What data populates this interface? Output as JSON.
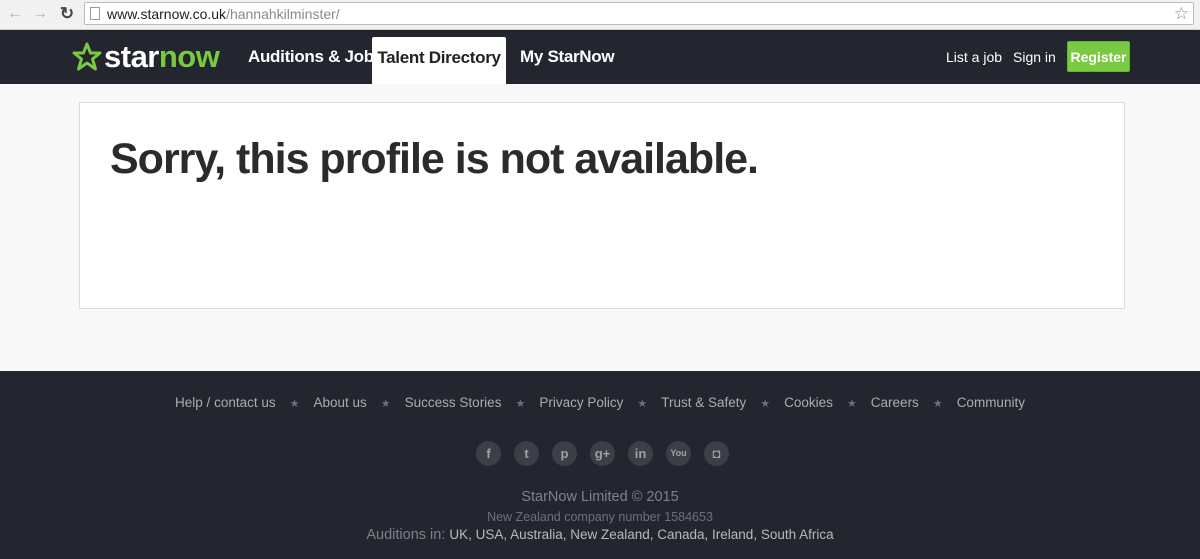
{
  "browser": {
    "url_domain": "www.starnow.co.uk",
    "url_path": "/hannahkilminster/",
    "icons": {
      "back": "back-arrow-icon",
      "forward": "forward-arrow-icon",
      "reload": "reload-icon",
      "bookmark": "bookmark-star-icon"
    }
  },
  "header": {
    "logo_white": "star",
    "logo_green": "now",
    "nav": {
      "auditions": "Auditions & Jobs",
      "talent": "Talent Directory",
      "mystarnow": "My StarNow"
    },
    "list_job": "List a job",
    "sign_in": "Sign in",
    "register": "Register"
  },
  "main": {
    "title": "Sorry, this profile is not available."
  },
  "footer": {
    "links": [
      "Help / contact us",
      "About us",
      "Success Stories",
      "Privacy Policy",
      "Trust & Safety",
      "Cookies",
      "Careers",
      "Community"
    ],
    "separator": "★",
    "social": [
      {
        "name": "facebook-icon",
        "glyph": "f"
      },
      {
        "name": "twitter-icon",
        "glyph": "t"
      },
      {
        "name": "pinterest-icon",
        "glyph": "p"
      },
      {
        "name": "google-plus-icon",
        "glyph": "g+"
      },
      {
        "name": "linkedin-icon",
        "glyph": "in"
      },
      {
        "name": "youtube-icon",
        "glyph": "You"
      },
      {
        "name": "instagram-icon",
        "glyph": "◘"
      }
    ],
    "copyright": "StarNow Limited © 2015",
    "company": "New Zealand company number 1584653",
    "auditions_label": "Auditions in:",
    "countries": "UK, USA, Australia, New Zealand, Canada, Ireland, South Africa"
  },
  "colors": {
    "brand_green": "#7ac943",
    "header_bg": "#23262f",
    "footer_bg": "#23262f"
  }
}
